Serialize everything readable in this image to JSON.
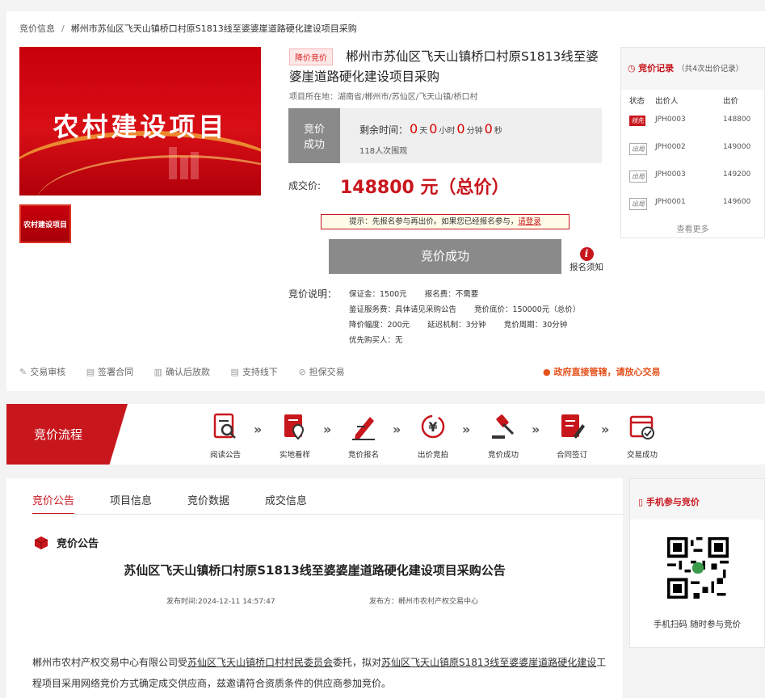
{
  "breadcrumb": {
    "root": "竞价信息",
    "sep": "/",
    "current": "郴州市苏仙区飞天山镇桥口村原S1813线至婆婆崖道路硬化建设项目采购"
  },
  "banner": {
    "title": "农村建设项目",
    "thumb_title": "农村建设项目"
  },
  "project": {
    "tag": "降价竞价",
    "title": "郴州市苏仙区飞天山镇桥口村原S1813线至婆婆崖道路硬化建设项目采购",
    "location_label": "项目所在地：",
    "location": "湖南省/郴州市/苏仙区/飞天山镇/桥口村"
  },
  "status": {
    "badge_line1": "竞价",
    "badge_line2": "成功",
    "remain_label": "剩余时间：",
    "days": "0",
    "days_unit": "天",
    "hours": "0",
    "hours_unit": "小时",
    "minutes": "0",
    "minutes_unit": "分钟",
    "seconds": "0",
    "seconds_unit": "秒",
    "viewers": "118人次围观"
  },
  "deal": {
    "label": "成交价:",
    "price": "148800 元（总价）"
  },
  "tip": {
    "text": "提示：先报名参与再出价。如果您已经报名参与，",
    "link": "请登录"
  },
  "action": {
    "button": "竞价成功",
    "notice": "报名须知"
  },
  "rules": {
    "label": "竞价说明：",
    "deposit": "保证金：1500元",
    "signup_fee": "报名费：不需要",
    "service_fee": "鉴证服务费：具体请见采购公告",
    "base_price": "竞价底价：150000元（总价）",
    "step": "降价幅度：200元",
    "delay": "延迟机制：3分钟",
    "cycle": "竞价周期：30分钟",
    "priority": "优先购买人：无"
  },
  "bottom_links": [
    "交易审核",
    "签署合同",
    "确认后放款",
    "支持线下",
    "担保交易"
  ],
  "gov_notice": "政府直接管辖，请放心交易",
  "bids": {
    "title": "竞价记录",
    "count": "（共4次出价记录）",
    "headers": [
      "状态",
      "出价人",
      "出价"
    ],
    "rows": [
      {
        "status": "领先",
        "bidder": "JPH0003",
        "price": "148800"
      },
      {
        "status": "出局",
        "bidder": "JPH0002",
        "price": "149000"
      },
      {
        "status": "出局",
        "bidder": "JPH0003",
        "price": "149200"
      },
      {
        "status": "出局",
        "bidder": "JPH0001",
        "price": "149600"
      }
    ],
    "more": "查看更多"
  },
  "process": {
    "title": "竞价流程",
    "arrow": "»",
    "steps": [
      "阅读公告",
      "实地看样",
      "竞价报名",
      "出价竞拍",
      "竞价成功",
      "合同签订",
      "交易成功"
    ]
  },
  "tabs": [
    "竞价公告",
    "项目信息",
    "竞价数据",
    "成交信息"
  ],
  "announcement": {
    "section": "竞价公告",
    "title": "苏仙区飞天山镇桥口村原S1813线至婆婆崖道路硬化建设项目采购公告",
    "published_at": "发布时间:2024-12-11 14:57:47",
    "publisher": "发布方：郴州市农村产权交易中心",
    "body_1": "郴州市农村产权交易中心有限公司受",
    "body_u1": "苏仙区飞天山镇桥口村村民委员会",
    "body_2": "委托，拟对",
    "body_u2": "苏仙区飞天山镇原S1813线至婆婆崖道路硬化建设",
    "body_3": "工程项目采用网络竞价方式确定成交供应商，兹邀请符合资质条件的供应商参加竞价。"
  },
  "mobile": {
    "title": "手机参与竞价",
    "caption": "手机扫码 随时参与竞价"
  },
  "colors": {
    "brand": "#c8161d",
    "grey_btn": "#8a8a8a",
    "gov": "#e6501b"
  }
}
